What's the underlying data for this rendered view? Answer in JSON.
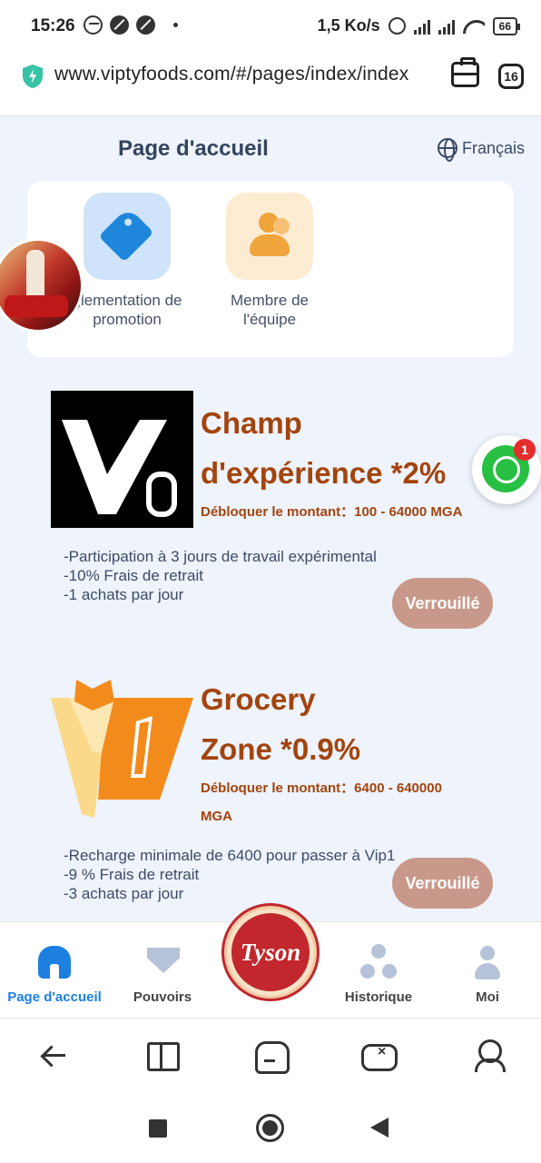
{
  "status_bar": {
    "time": "15:26",
    "net_speed": "1,5 Ko/s",
    "battery": "66"
  },
  "browser": {
    "url": "www.viptyfoods.com/#/pages/index/index",
    "tab_count": "16"
  },
  "header": {
    "title": "Page d'accueil",
    "language": "Français"
  },
  "menu": {
    "items": [
      {
        "label_line1": "glementation de",
        "label_line2": "promotion",
        "icon": "tag-icon"
      },
      {
        "label_line1": "Membre de",
        "label_line2": "l'équipe",
        "icon": "team-icon"
      }
    ]
  },
  "whatsapp": {
    "badge": "1"
  },
  "vips": [
    {
      "name_line1": "Champ",
      "name_line2": "d'expérience  *2%",
      "unlock_line1": "Débloquer le montant：100 - 64000 MGA",
      "unlock_line2": "",
      "features": [
        "-Participation à 3 jours de travail expérimental",
        "-10% Frais de retrait",
        "-1 achats par jour"
      ],
      "button": "Verrouillé"
    },
    {
      "name_line1": "Grocery",
      "name_line2": "Zone  *0.9%",
      "unlock_line1": "Débloquer le montant：6400 - 640000",
      "unlock_line2": "MGA",
      "features": [
        "-Recharge minimale de 6400 pour passer à Vip1",
        "-9 % Frais de retrait",
        "-3 achats par jour"
      ],
      "button": "Verrouillé"
    }
  ],
  "tabbar": {
    "home": "Page d'accueil",
    "powers": "Pouvoirs",
    "center_logo": "Tyson",
    "history": "Historique",
    "me": "Moi"
  },
  "colors": {
    "accent": "#1d7fe0",
    "vip_text": "#a3440d",
    "locked_button": "#c8998a",
    "page_bg": "#eef3fc"
  }
}
